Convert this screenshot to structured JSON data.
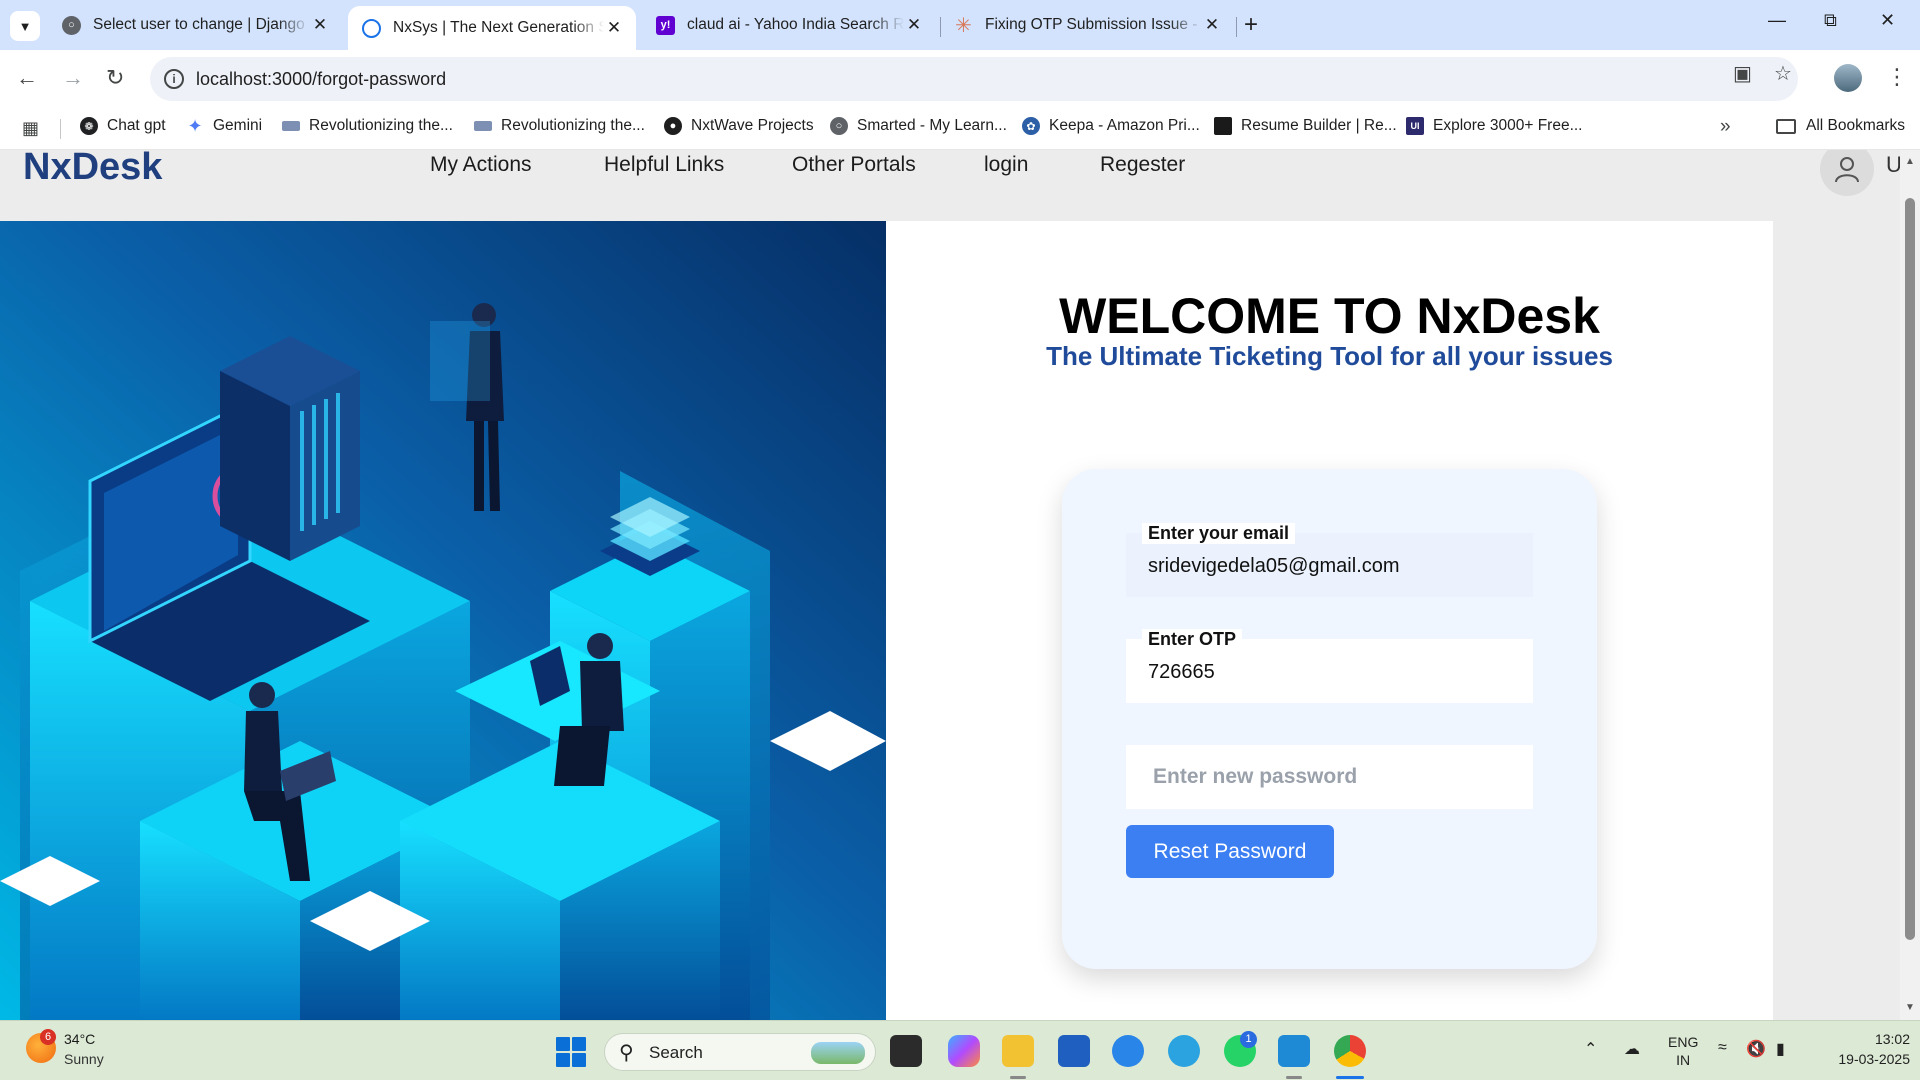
{
  "browser": {
    "tabs": [
      {
        "title": "Select user to change | Django site admin",
        "favicon": "globe-icon",
        "active": false
      },
      {
        "title": "NxSys | The Next Generation System",
        "favicon": "loading-icon",
        "active": true
      },
      {
        "title": "claud ai - Yahoo India Search Results",
        "favicon": "yahoo-icon",
        "active": false
      },
      {
        "title": "Fixing OTP Submission Issue - Claude",
        "favicon": "claude-icon",
        "active": false
      }
    ],
    "new_tab_symbol": "+",
    "url": "localhost:3000/forgot-password",
    "bookmarks": [
      {
        "label": "Chat gpt",
        "icon": "chatgpt-icon"
      },
      {
        "label": "Gemini",
        "icon": "gemini-icon"
      },
      {
        "label": "Revolutionizing the...",
        "icon": "site-icon"
      },
      {
        "label": "Revolutionizing the...",
        "icon": "site-icon"
      },
      {
        "label": "NxtWave Projects",
        "icon": "github-icon"
      },
      {
        "label": "Smarted - My Learn...",
        "icon": "globe-icon"
      },
      {
        "label": "Keepa - Amazon Pri...",
        "icon": "keepa-icon"
      },
      {
        "label": "Resume Builder | Re...",
        "icon": "resume-icon"
      },
      {
        "label": "Explore 3000+ Free...",
        "icon": "ui-icon"
      }
    ],
    "all_bookmarks_label": "All Bookmarks"
  },
  "page": {
    "brand": "NxDesk",
    "nav": [
      "My Actions",
      "Helpful Links",
      "Other Portals",
      "login",
      "Regester"
    ],
    "user_initial": "U",
    "welcome_title": "WELCOME TO NxDesk",
    "tagline": "The Ultimate Ticketing Tool for all your issues",
    "form": {
      "email_label": "Enter your email",
      "email_value": "sridevigedela05@gmail.com",
      "otp_label": "Enter OTP",
      "otp_value": "726665",
      "password_placeholder": "Enter new password",
      "submit_label": "Reset Password"
    }
  },
  "taskbar": {
    "weather_temp": "34°C",
    "weather_condition": "Sunny",
    "weather_badge": "6",
    "search_label": "Search",
    "whatsapp_badge": "1",
    "lang_line1": "ENG",
    "lang_line2": "IN",
    "time": "13:02",
    "date": "19-03-2025"
  },
  "colors": {
    "tabstrip": "#d3e3fd",
    "brand_text": "#1f3f7f",
    "tagline_text": "#1f4b9a",
    "button": "#3b7ff3",
    "card_bg": "#f0f6ff",
    "taskbar": "#dce9d4"
  }
}
